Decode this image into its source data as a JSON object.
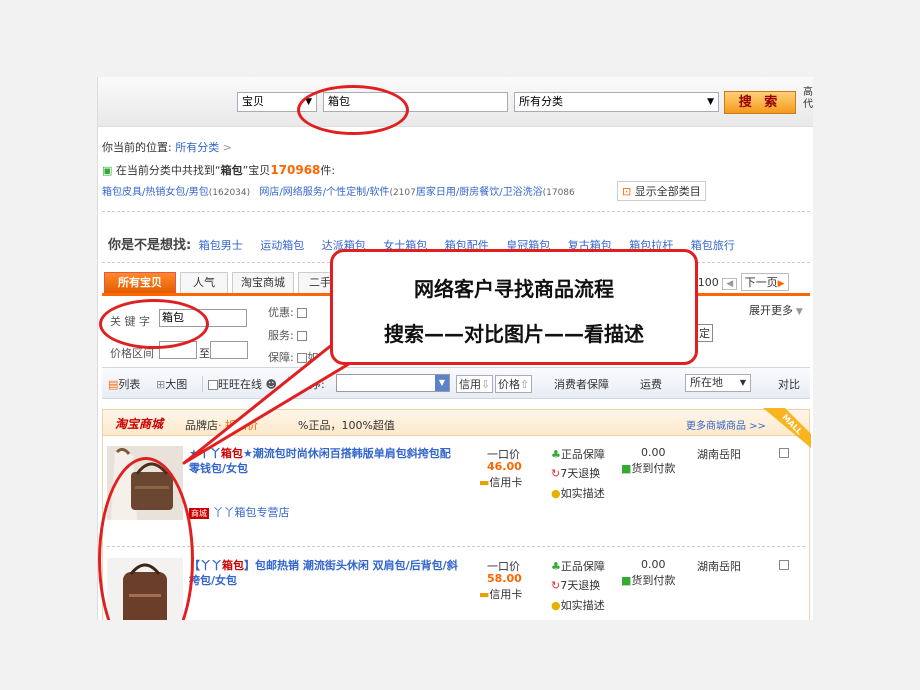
{
  "top": {
    "scope": "宝贝",
    "query": "箱包",
    "category": "所有分类",
    "search_label": "搜 索",
    "side_chars": [
      "高",
      "代"
    ]
  },
  "location": {
    "label": "你当前的位置:",
    "link": "所有分类",
    "arrow": ">"
  },
  "result": {
    "prefix": "在当前分类中共找到“",
    "keyword": "箱包",
    "middle": "”宝贝",
    "count": "170968",
    "suffix": "件:"
  },
  "categories": [
    {
      "name": "箱包皮具/热销女包/男包",
      "count": "(162034)"
    },
    {
      "name": "网店/网络服务/个性定制/软件",
      "count": "(2107"
    },
    {
      "name": "居家日用/厨房餐饮/卫浴洗浴",
      "count": "(17086"
    }
  ],
  "show_all": "显示全部类目",
  "suggest": {
    "label": "你是不是想找:",
    "items": [
      "箱包男士",
      "运动箱包",
      "达派箱包",
      "女士箱包",
      "箱包配件",
      "皇冠箱包",
      "复古箱包",
      "箱包拉杆",
      "箱包旅行"
    ]
  },
  "tabs": [
    "所有宝贝",
    "人气",
    "淘宝商城",
    "二手"
  ],
  "paging": {
    "text": "/100",
    "prev": "◀",
    "next": "下一页"
  },
  "filters": {
    "keyword_label": "关 键 字",
    "keyword_value": "箱包",
    "price_label": "价格区间",
    "price_to": "至",
    "promo_label": "优惠:",
    "service_label": "服务:",
    "guarantee_label": "保障:",
    "guarantee_partial": "如",
    "expand": "展开更多",
    "confirm_partial": "定"
  },
  "sortbar": {
    "list": "列表",
    "grid": "大图",
    "online": "旺旺在线",
    "sort_label": "排序:",
    "credit": "信用",
    "price": "价格",
    "consumer": "消费者保障",
    "shipping": "运费",
    "location": "所在地",
    "compare": "对比"
  },
  "mall": {
    "logo": "淘宝商城",
    "tagline_a": "品牌店",
    "tagline_b": "· 折扣价",
    "tagline_c": "%正品，100%超值",
    "more": "更多商城商品 >>",
    "corner": "MALL"
  },
  "products": [
    {
      "title_a": "★丫丫",
      "title_kw": "箱包",
      "title_b": "★潮流包时尚休闲百搭韩版单肩包斜挎包配零钱包/女包",
      "price_type": "一口价",
      "price": "46.00",
      "pay": "信用卡",
      "badges": [
        "正品保障",
        "7天退换",
        "如实描述"
      ],
      "freight": "0.00",
      "cod": "货到付款",
      "location": "湖南岳阳",
      "shop_tag": "商城",
      "shop": "丫丫箱包专营店"
    },
    {
      "title_a": "【丫丫",
      "title_kw": "箱包",
      "title_b": "】包邮热销 潮流街头休闲 双肩包/后背包/斜挎包/女包",
      "price_type": "一口价",
      "price": "58.00",
      "pay": "信用卡",
      "badges": [
        "正品保障",
        "7天退换",
        "如实描述"
      ],
      "freight": "0.00",
      "cod": "货到付款",
      "location": "湖南岳阳"
    }
  ],
  "callout": {
    "title": "网络客户寻找商品流程",
    "subtitle": "搜索——对比图片——看描述"
  },
  "colors": {
    "accent": "#ff6600",
    "highlight": "#e02020",
    "link": "#3366cc"
  }
}
